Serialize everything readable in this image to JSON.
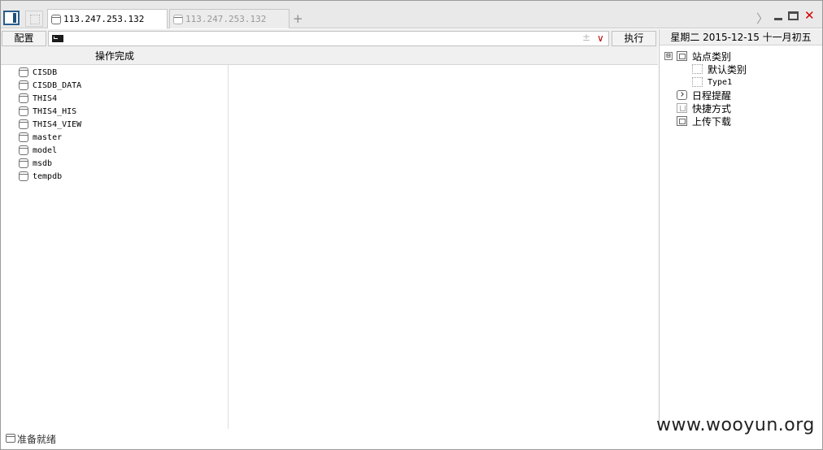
{
  "tabs": [
    {
      "label": "113.247.253.132",
      "active": true
    },
    {
      "label": "113.247.253.132",
      "active": false
    }
  ],
  "toolbar": {
    "new_tab_glyph": "+",
    "overflow_glyph": "〉",
    "close_glyph": "✕",
    "config_label": "配置",
    "command_value": "",
    "plusminus_glyph": "±",
    "dropdown_glyph": "∨",
    "execute_label": "执行"
  },
  "operation_status": "操作完成",
  "databases": [
    "CISDB",
    "CISDB_DATA",
    "THIS4",
    "THIS4_HIS",
    "THIS4_VIEW",
    "master",
    "model",
    "msdb",
    "tempdb"
  ],
  "right_panel": {
    "date_text": "星期二 2015-12-15 十一月初五",
    "tree": {
      "collapse_glyph": "⊟",
      "site_category": "站点类别",
      "default_category": "默认类别",
      "type1": "Type1",
      "schedule_reminder": "日程提醒",
      "shortcuts": "快捷方式",
      "upload_download": "上传下载"
    }
  },
  "status_bar": {
    "text": "准备就绪"
  },
  "watermark": "www.wooyun.org",
  "colors": {
    "close_red": "#d40000",
    "accent_blue": "#2a5d8c"
  }
}
